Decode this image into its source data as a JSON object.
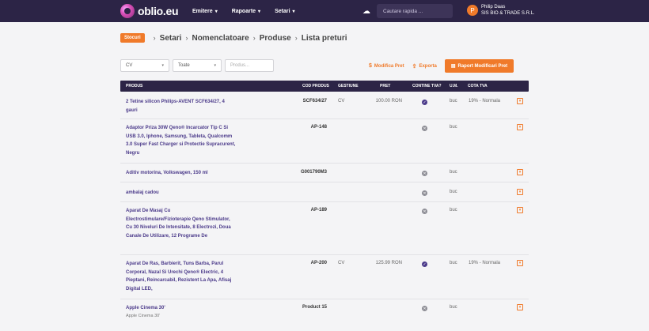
{
  "brand": {
    "logo_text": "oblio.eu"
  },
  "nav": [
    {
      "label": "Emitere"
    },
    {
      "label": "Rapoarte"
    },
    {
      "label": "Setari"
    }
  ],
  "search": {
    "placeholder": "Cautare rapida ..."
  },
  "user": {
    "name": "Philip Daas",
    "company": "SIS BIO & TRADE S.R.L.",
    "initial": "P"
  },
  "breadcrumb": {
    "badge": "Stocuri",
    "items": [
      "Setari",
      "Nomenclatoare",
      "Produse",
      "Lista preturi"
    ]
  },
  "filters": {
    "currency": "CV",
    "type": "Toate",
    "product_placeholder": "Produs..."
  },
  "actions": {
    "modify_price": "Modifica Pret",
    "export": "Exporta",
    "report": "Raport Modificari Pret"
  },
  "table": {
    "headers": {
      "product": "PRODUS",
      "code": "COD PRODUS",
      "management": "GESTIUNE",
      "price": "PRET",
      "vat_included": "CONTINE TVA?",
      "unit": "U.M.",
      "vat_rate": "COTA TVA"
    },
    "rows": [
      {
        "name": "2 Tetine silicon Philips-AVENT SCF634/27, 4 gauri",
        "note": "",
        "code": "SCF634/27",
        "management": "CV",
        "price": "100.00 RON",
        "vat": "check",
        "unit": "buc",
        "vat_rate": "19% - Normala"
      },
      {
        "name": "Adaptor Priza 30W Qeno® Incarcator Tip C Si USB 3.0, Iphone, Samsung, Tableta, Qualcomm 3.0 Super Fast Charger si Protectie Supracurent, Negru",
        "note": "",
        "code": "AP-148",
        "management": "",
        "price": "",
        "vat": "cross",
        "unit": "buc",
        "vat_rate": ""
      },
      {
        "name": "Aditiv motorina, Volkswagen, 150 ml",
        "note": "",
        "code": "G001790M3",
        "management": "",
        "price": "",
        "vat": "cross",
        "unit": "buc",
        "vat_rate": ""
      },
      {
        "name": "ambalaj cadou",
        "note": "",
        "code": "",
        "management": "",
        "price": "",
        "vat": "cross",
        "unit": "buc",
        "vat_rate": ""
      },
      {
        "name": "Aparat De Masaj Cu Electrostimulare/Fizioterapie Qeno Stimulator, Cu 30 Niveluri De Intensitate, 8 Electrozi, Doua Canale De Utilizare, 12 Programe De",
        "note": "",
        "code": "AP-189",
        "management": "",
        "price": "",
        "vat": "cross",
        "unit": "buc",
        "vat_rate": ""
      },
      {
        "name": "Aparat De Ras, Barbierit, Tuns Barba, Parul Corporal, Nazal Si Urechi Qeno® Electric, 4 Pieptani, Reincarcabil, Rezistent La Apa, Afisaj Digital LED,",
        "note": "",
        "code": "AP-200",
        "management": "CV",
        "price": "125.99 RON",
        "vat": "check",
        "unit": "buc",
        "vat_rate": "19% - Normala"
      },
      {
        "name": "Apple Cinema 30'",
        "note": "Apple Cinema 30'",
        "code": "Product 15",
        "management": "",
        "price": "",
        "vat": "cross",
        "unit": "buc",
        "vat_rate": ""
      }
    ]
  }
}
